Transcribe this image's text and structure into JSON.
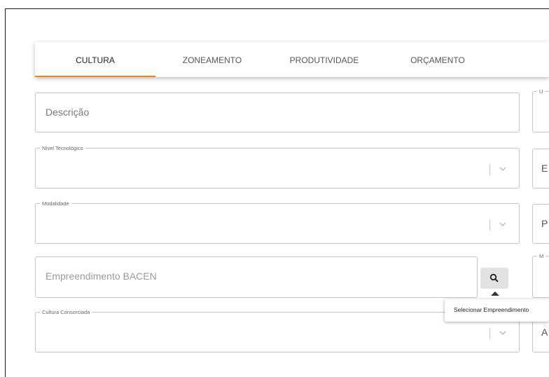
{
  "tabs": [
    {
      "label": "CULTURA",
      "active": true
    },
    {
      "label": "ZONEAMENTO",
      "active": false
    },
    {
      "label": "PRODUTIVIDADE",
      "active": false
    },
    {
      "label": "ORÇAMENTO",
      "active": false
    }
  ],
  "form": {
    "descricao": {
      "placeholder": "Descrição"
    },
    "nivel_tecnologico": {
      "label": "Nível Tecnológico",
      "value": ""
    },
    "modalidade": {
      "label": "Modalidade",
      "value": ""
    },
    "empreendimento": {
      "placeholder": "Empreendimento BACEN"
    },
    "cultura_consorciada": {
      "label": "Cultura Consorciada",
      "value": ""
    }
  },
  "right_column": {
    "field1_label": "U",
    "field2_text": "E",
    "field3_text": "P",
    "field4_label": "M",
    "field5_text": "A"
  },
  "search_button": {
    "icon": "search-icon"
  },
  "tooltip": {
    "text": "Selecionar Empreendimento"
  },
  "colors": {
    "accent": "#e9822b",
    "border": "#c4c4c4",
    "search_bg": "#e2e2e2"
  }
}
